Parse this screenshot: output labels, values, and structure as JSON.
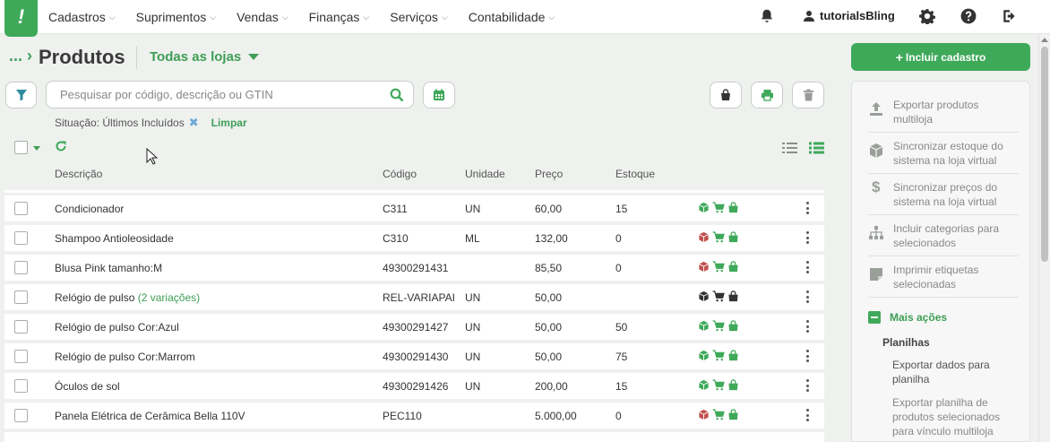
{
  "nav": {
    "items": [
      "Cadastros",
      "Suprimentos",
      "Vendas",
      "Finanças",
      "Serviços",
      "Contabilidade"
    ],
    "user": "tutorialsBling"
  },
  "page": {
    "breadcrumb": "...",
    "title": "Produtos",
    "store_filter": "Todas as lojas"
  },
  "search": {
    "placeholder": "Pesquisar por código, descrição ou GTIN"
  },
  "filter": {
    "label": "Situação: Últimos Incluídos",
    "clear": "Limpar"
  },
  "table": {
    "columns": [
      "Descrição",
      "Código",
      "Unidade",
      "Preço",
      "Estoque"
    ],
    "rows": [
      {
        "descricao": "Condicionador",
        "variacoes": "",
        "codigo": "C311",
        "unidade": "UN",
        "preco": "60,00",
        "estoque": "15",
        "box_color": "green",
        "bag_color": "green"
      },
      {
        "descricao": "Shampoo Antioleosidade",
        "variacoes": "",
        "codigo": "C310",
        "unidade": "ML",
        "preco": "132,00",
        "estoque": "0",
        "box_color": "red",
        "bag_color": "green"
      },
      {
        "descricao": "Blusa Pink tamanho:M",
        "variacoes": "",
        "codigo": "49300291431",
        "unidade": "",
        "preco": "85,50",
        "estoque": "0",
        "box_color": "red",
        "bag_color": "green"
      },
      {
        "descricao": "Relógio de pulso",
        "variacoes": "(2 variações)",
        "codigo": "REL-VARIAPAI",
        "unidade": "UN",
        "preco": "50,00",
        "estoque": "",
        "box_color": "dark",
        "bag_color": "dark"
      },
      {
        "descricao": "Relógio de pulso Cor:Azul",
        "variacoes": "",
        "codigo": "49300291427",
        "unidade": "UN",
        "preco": "50,00",
        "estoque": "50",
        "box_color": "green",
        "bag_color": "green"
      },
      {
        "descricao": "Relógio de pulso Cor:Marrom",
        "variacoes": "",
        "codigo": "49300291430",
        "unidade": "UN",
        "preco": "50,00",
        "estoque": "75",
        "box_color": "green",
        "bag_color": "green"
      },
      {
        "descricao": "Óculos de sol",
        "variacoes": "",
        "codigo": "49300291426",
        "unidade": "UN",
        "preco": "200,00",
        "estoque": "15",
        "box_color": "green",
        "bag_color": "green"
      },
      {
        "descricao": "Panela Elétrica de Cerâmica Bella 110V",
        "variacoes": "",
        "codigo": "PEC110",
        "unidade": "",
        "preco": "5.000,00",
        "estoque": "0",
        "box_color": "red",
        "bag_color": "green"
      }
    ]
  },
  "actions": {
    "include": "Incluir cadastro",
    "items": [
      "Exportar produtos multiloja",
      "Sincronizar estoque do sistema na loja virtual",
      "Sincronizar preços do sistema na loja virtual",
      "Incluir categorias para selecionados",
      "Imprimir etiquetas selecionadas"
    ],
    "more": "Mais ações",
    "spreadsheets_title": "Planilhas",
    "spreadsheets": [
      "Exportar dados para planilha",
      "Exportar planilha de produtos selecionados para vínculo multiloja"
    ]
  },
  "colors": {
    "accent": "#3fa95a",
    "accent_text": "#3f9e56",
    "red_icon": "#c0504d",
    "dark_icon": "#333333"
  },
  "icons": [
    "filter-icon",
    "search-icon",
    "calendar-icon",
    "bag-icon",
    "print-icon",
    "trash-icon",
    "refresh-icon",
    "bell-icon",
    "user-icon",
    "gear-icon",
    "help-icon",
    "logout-icon",
    "box-icon",
    "cart-icon",
    "list-compact-icon",
    "list-icon"
  ]
}
